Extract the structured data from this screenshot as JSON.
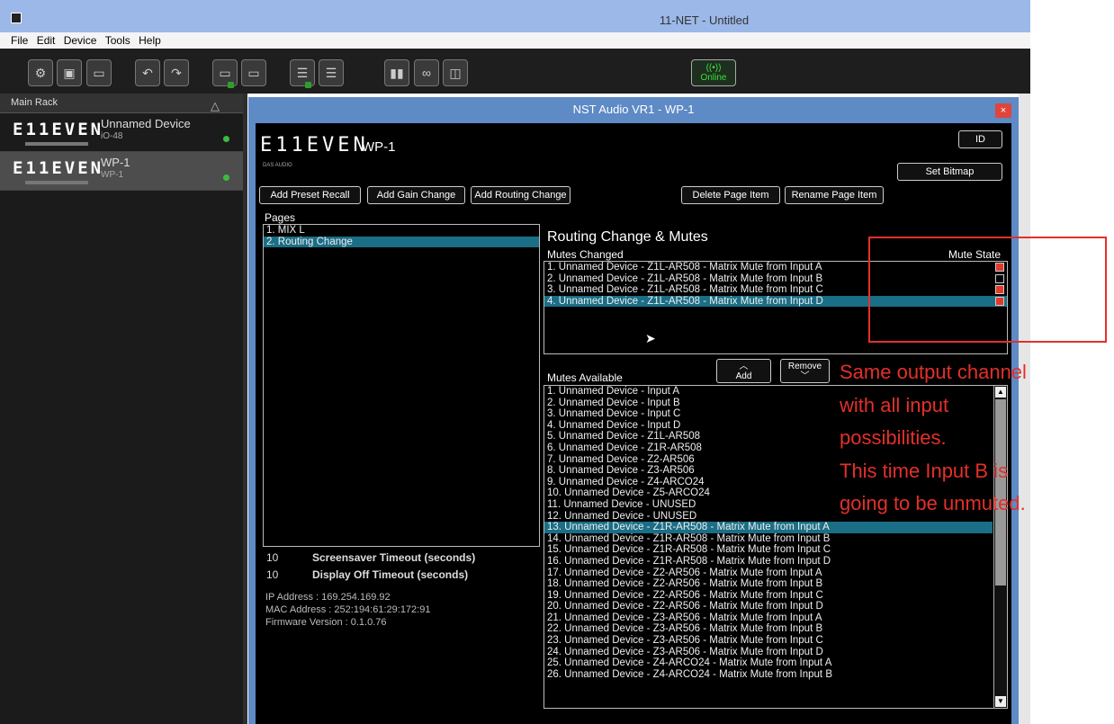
{
  "window": {
    "title": "11-NET - Untitled"
  },
  "menu": [
    "File",
    "Edit",
    "Device",
    "Tools",
    "Help"
  ],
  "toolbar": {
    "buttons": [
      "settings",
      "save",
      "open",
      "undo",
      "redo",
      "add-device",
      "remove-device",
      "add-page",
      "remove-page",
      "meters",
      "link",
      "snapshot"
    ],
    "online_label": "Online"
  },
  "rack": {
    "title": "Main Rack",
    "devices": [
      {
        "logo": "E11EVEN",
        "name": "Unnamed Device",
        "model": "iO-48"
      },
      {
        "logo": "E11EVEN",
        "name": "WP-1",
        "model": "WP-1"
      }
    ]
  },
  "dialog": {
    "title": "NST Audio VR1 - WP-1",
    "close": "×",
    "brand": "E11EVEN",
    "brand_sub": "DAS AUDIO",
    "device_title": "WP-1",
    "id_button": "ID",
    "set_bitmap": "Set Bitmap",
    "buttons": {
      "add_preset_recall": "Add Preset Recall",
      "add_gain_change": "Add Gain Change",
      "add_routing_change": "Add Routing Change",
      "delete_page_item": "Delete Page Item",
      "rename_page_item": "Rename Page Item",
      "add": "Add",
      "remove": "Remove"
    },
    "pages_label": "Pages",
    "pages": [
      "1. MIX L",
      "2. Routing Change"
    ],
    "section_heading": "Routing Change & Mutes",
    "mutes_changed_label": "Mutes Changed",
    "mute_state_label": "Mute State",
    "mutes_changed": [
      {
        "label": "1. Unnamed Device - Z1L-AR508 - Matrix Mute from Input A",
        "muted": true
      },
      {
        "label": "2. Unnamed Device - Z1L-AR508 - Matrix Mute from Input B",
        "muted": false
      },
      {
        "label": "3. Unnamed Device - Z1L-AR508 - Matrix Mute from Input C",
        "muted": true
      },
      {
        "label": "4. Unnamed Device - Z1L-AR508 - Matrix Mute from Input D",
        "muted": true
      }
    ],
    "mutes_available_label": "Mutes Available",
    "mutes_available": [
      "1. Unnamed Device - Input A",
      "2. Unnamed Device - Input B",
      "3. Unnamed Device - Input C",
      "4. Unnamed Device - Input D",
      "5. Unnamed Device - Z1L-AR508",
      "6. Unnamed Device - Z1R-AR508",
      "7. Unnamed Device - Z2-AR506",
      "8. Unnamed Device - Z3-AR506",
      "9. Unnamed Device - Z4-ARCO24",
      "10. Unnamed Device - Z5-ARCO24",
      "11. Unnamed Device - UNUSED",
      "12. Unnamed Device - UNUSED",
      "13. Unnamed Device - Z1R-AR508 - Matrix Mute from Input A",
      "14. Unnamed Device - Z1R-AR508 - Matrix Mute from Input B",
      "15. Unnamed Device - Z1R-AR508 - Matrix Mute from Input C",
      "16. Unnamed Device - Z1R-AR508 - Matrix Mute from Input D",
      "17. Unnamed Device - Z2-AR506 - Matrix Mute from Input A",
      "18. Unnamed Device - Z2-AR506 - Matrix Mute from Input B",
      "19. Unnamed Device - Z2-AR506 - Matrix Mute from Input C",
      "20. Unnamed Device - Z2-AR506 - Matrix Mute from Input D",
      "21. Unnamed Device - Z3-AR506 - Matrix Mute from Input A",
      "22. Unnamed Device - Z3-AR506 - Matrix Mute from Input B",
      "23. Unnamed Device - Z3-AR506 - Matrix Mute from Input C",
      "24. Unnamed Device - Z3-AR506 - Matrix Mute from Input D",
      "25. Unnamed Device - Z4-ARCO24 - Matrix Mute from Input A",
      "26. Unnamed Device - Z4-ARCO24 - Matrix Mute from Input B"
    ],
    "selected_available": 12,
    "screensaver": {
      "value": "10",
      "label": "Screensaver Timeout (seconds)"
    },
    "display_off": {
      "value": "10",
      "label": "Display Off Timeout (seconds)"
    },
    "ip_address": "IP Address : 169.254.169.92",
    "mac_address": "MAC Address : 252:194:61:29:172:91",
    "firmware": "Firmware Version : 0.1.0.76"
  },
  "annotation": {
    "lines": [
      "Same output channel",
      "with all input",
      "possibilities.",
      "This time Input B is",
      "going to be unmuted."
    ],
    "color": "#e3302a"
  }
}
